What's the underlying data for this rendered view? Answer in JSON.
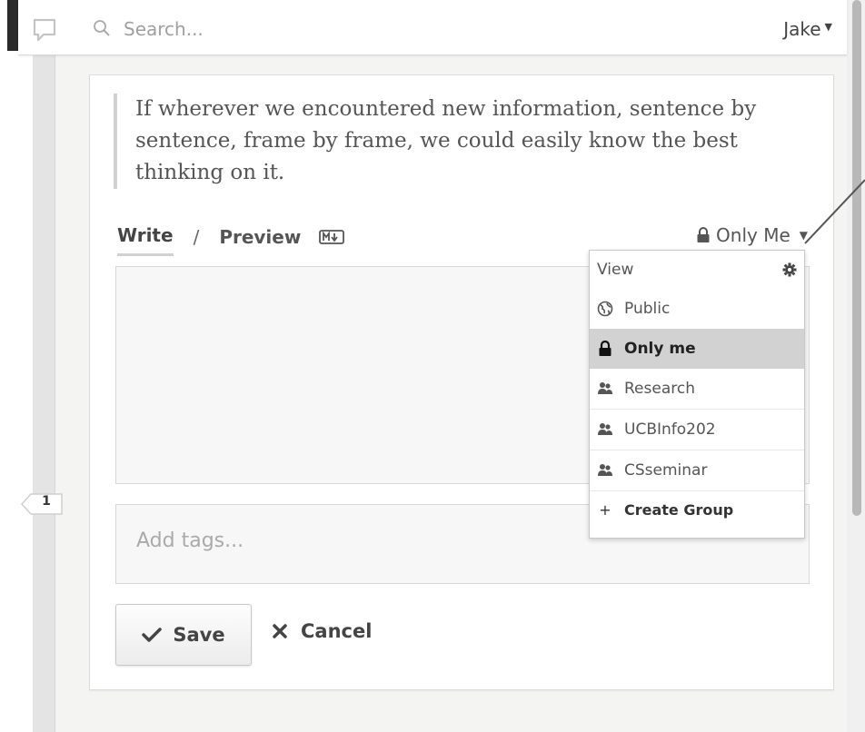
{
  "topbar": {
    "search_placeholder": "Search...",
    "user_name": "Jake",
    "user_caret": "▼"
  },
  "annotation": {
    "quote": "If wherever we encountered new information, sentence by sentence, frame by frame, we could easily know the best thinking on it.",
    "tab_write": "Write",
    "tab_separator": "/",
    "tab_preview": "Preview",
    "privacy_label": "Only Me",
    "privacy_caret": "▼",
    "tags_placeholder": "Add tags...",
    "save_label": "Save",
    "cancel_label": "Cancel"
  },
  "dropdown": {
    "header": "View",
    "items": [
      {
        "label": "Public",
        "icon": "globe-icon"
      },
      {
        "label": "Only me",
        "icon": "lock-icon",
        "selected": true
      },
      {
        "label": "Research",
        "icon": "group-icon"
      },
      {
        "label": "UCBInfo202",
        "icon": "group-icon"
      },
      {
        "label": "CSseminar",
        "icon": "group-icon"
      }
    ],
    "create_label": "Create Group",
    "create_symbol": "+"
  },
  "marker": {
    "count": "1"
  },
  "colors": {
    "selected_bg": "#d2d2d2",
    "gutter": "#e4e4e4",
    "left_bar": "#2a2a2a"
  }
}
